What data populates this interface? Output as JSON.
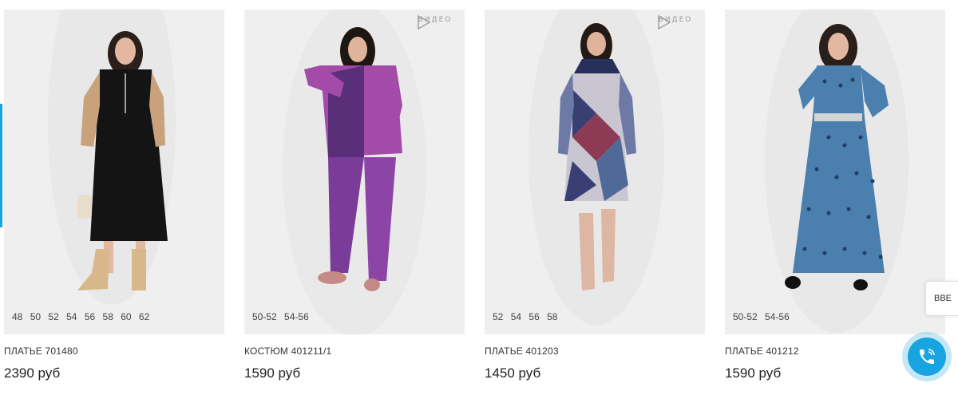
{
  "products": [
    {
      "name": "ПЛАТЬЕ 701480",
      "price": "2390 руб",
      "sizes": [
        "48",
        "50",
        "52",
        "54",
        "56",
        "58",
        "60",
        "62"
      ],
      "has_video": false
    },
    {
      "name": "КОСТЮМ 401211/1",
      "price": "1590 руб",
      "sizes": [
        "50-52",
        "54-56"
      ],
      "has_video": true,
      "video_label": "ВИДЕО"
    },
    {
      "name": "ПЛАТЬЕ 401203",
      "price": "1450 руб",
      "sizes": [
        "52",
        "54",
        "56",
        "58"
      ],
      "has_video": true,
      "video_label": "ВИДЕО"
    },
    {
      "name": "ПЛАТЬЕ 401212",
      "price": "1590 руб",
      "sizes": [
        "50-52",
        "54-56"
      ],
      "has_video": false
    }
  ],
  "side_tab": {
    "label": "ВВЕ"
  },
  "call_button": {
    "icon": "phone-icon"
  },
  "colors": {
    "accent": "#18a4e0",
    "card_bg": "#efefef"
  }
}
